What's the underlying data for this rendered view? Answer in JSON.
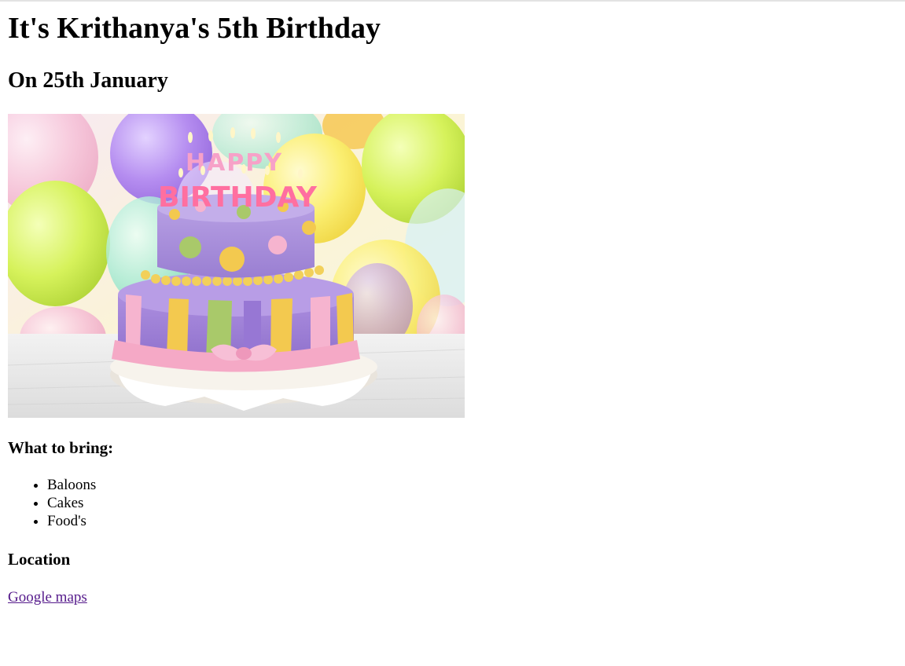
{
  "page": {
    "title": "It's Krithanya's 5th Birthday",
    "subtitle": "On 25th January",
    "image": {
      "topper_line1": "HAPPY",
      "topper_line2": "BIRTHDAY"
    },
    "bring": {
      "heading": "What to bring:",
      "items": [
        "Baloons",
        "Cakes",
        "Food's"
      ]
    },
    "location": {
      "heading": "Location",
      "link_text": "Google maps"
    }
  },
  "colors": {
    "link_visited": "#551a8b",
    "text": "#000000",
    "cake_purple": "#a98bd9",
    "cake_pink": "#f6b4cf",
    "cake_yellow": "#f3c94f",
    "cake_green": "#a9c96a"
  }
}
